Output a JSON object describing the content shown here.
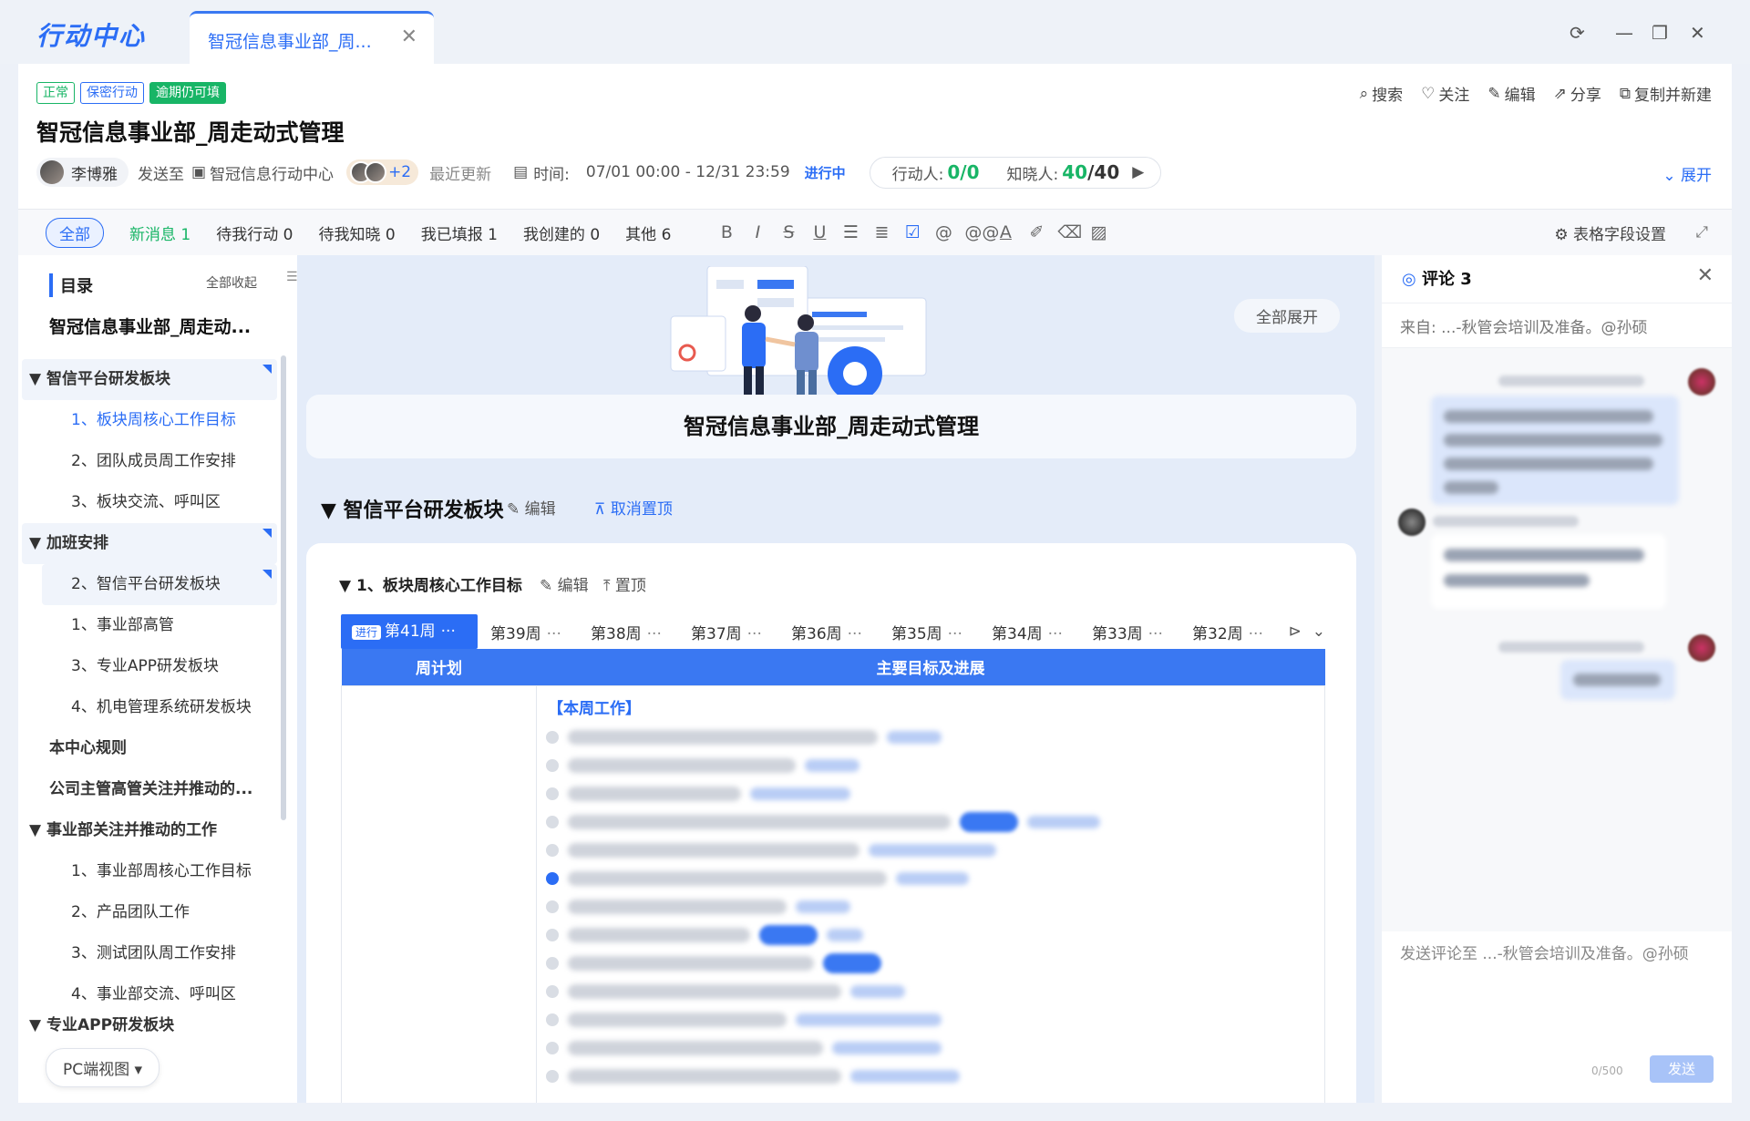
{
  "app": {
    "logo": "行动中心",
    "tab_title": "智冠信息事业部_周...",
    "tab_close": "✕"
  },
  "window_controls": {
    "refresh": "⟳",
    "minimize": "—",
    "restore": "❐",
    "close": "✕"
  },
  "header": {
    "badges": {
      "normal": "正常",
      "secret": "保密行动",
      "overdue": "逾期仍可填"
    },
    "title": "智冠信息事业部_周走动式管理",
    "actions": {
      "search": "搜索",
      "follow": "关注",
      "edit": "编辑",
      "share": "分享",
      "copy_new": "复制并新建"
    },
    "owner": "李博雅",
    "send_to_label": "发送至",
    "send_to_target": "智冠信息行动中心",
    "more_count": "+2",
    "recent_update": "最近更新",
    "time_label": "时间:",
    "time_range": "07/01 00:00 - 12/31 23:59",
    "status": "进行中",
    "actor_label": "行动人:",
    "actor_value": "0/0",
    "informed_label": "知晓人:",
    "informed_done": "40",
    "informed_total": "/40",
    "expand": "展开"
  },
  "filters": {
    "all": "全部",
    "new_msg": "新消息 1",
    "pending_action": "待我行动 0",
    "pending_know": "待我知晓 0",
    "reported": "我已填报 1",
    "created": "我创建的 0",
    "other": "其他 6",
    "table_settings": "表格字段设置"
  },
  "sidebar": {
    "heading": "目录",
    "collapse_all": "全部收起",
    "root": "智冠信息事业部_周走动...",
    "items": [
      {
        "label": "▼  智信平台研发板块"
      },
      {
        "label": "1、板块周核心工作目标"
      },
      {
        "label": "2、团队成员周工作安排"
      },
      {
        "label": "3、板块交流、呼叫区"
      },
      {
        "label": "▼  加班安排"
      },
      {
        "label": "2、智信平台研发板块"
      },
      {
        "label": "1、事业部高管"
      },
      {
        "label": "3、专业APP研发板块"
      },
      {
        "label": "4、机电管理系统研发板块"
      },
      {
        "label": "本中心规则"
      },
      {
        "label": "公司主管高管关注并推动的..."
      },
      {
        "label": "▼  事业部关注并推动的工作"
      },
      {
        "label": "1、事业部周核心工作目标"
      },
      {
        "label": "2、产品团队工作"
      },
      {
        "label": "3、测试团队周工作安排"
      },
      {
        "label": "4、事业部交流、呼叫区"
      },
      {
        "label": "▼  专业APP研发板块"
      }
    ],
    "pc_view": "PC端视图 ▾"
  },
  "main": {
    "expand_all": "全部展开",
    "hero_title": "智冠信息事业部_周走动式管理",
    "section_title": "▼  智信平台研发板块",
    "section_edit": "编辑",
    "section_unpin": "取消置顶",
    "sub_title": "▼  1、板块周核心工作目标",
    "sub_edit": "编辑",
    "sub_pin": "置顶",
    "week_tabs": [
      {
        "tag": "进行",
        "label": "第41周"
      },
      {
        "label": "第39周"
      },
      {
        "label": "第38周"
      },
      {
        "label": "第37周"
      },
      {
        "label": "第36周"
      },
      {
        "label": "第35周"
      },
      {
        "label": "第34周"
      },
      {
        "label": "第33周"
      },
      {
        "label": "第32周"
      }
    ],
    "dots": "···",
    "table_headers": [
      "周计划",
      "主要目标及进展"
    ],
    "work_heading": "【本周工作】"
  },
  "comments": {
    "title": "评论 3",
    "from": "来自: ...-秋管会培训及准备。@孙硕",
    "input_placeholder": "发送评论至 ...-秋管会培训及准备。@孙硕",
    "counter": "0/500",
    "send": "发送"
  },
  "colors": {
    "accent": "#2b6df5",
    "success": "#18b566",
    "header_blue": "#3a78f2"
  }
}
